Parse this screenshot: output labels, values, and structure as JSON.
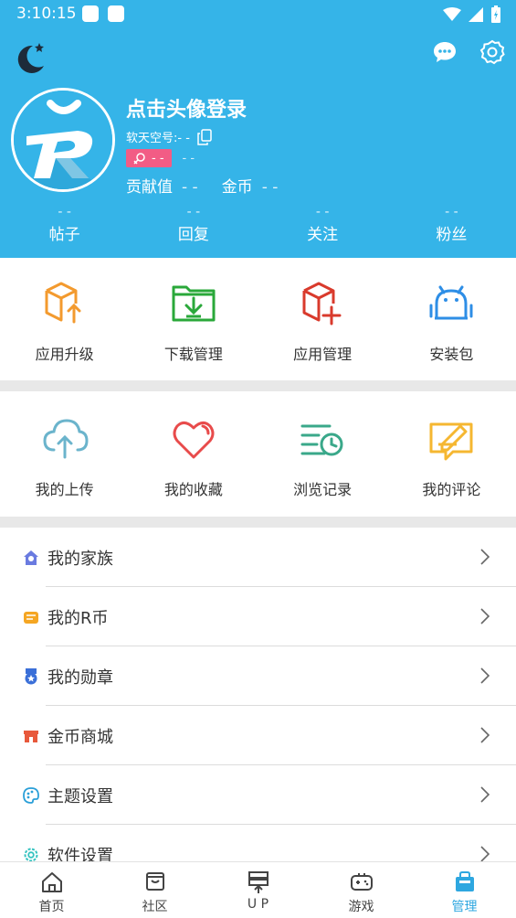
{
  "status_bar": {
    "time": "3:10:15"
  },
  "profile": {
    "login_prompt": "点击头像登录",
    "id_label": "软天空号:- -",
    "badge_value": "- -",
    "badge_extra": "- -",
    "contribution_label": "贡献值",
    "contribution_value": "- -",
    "coins_label": "金币",
    "coins_value": "- -"
  },
  "counts": [
    {
      "value": "- -",
      "label": "帖子"
    },
    {
      "value": "- -",
      "label": "回复"
    },
    {
      "value": "- -",
      "label": "关注"
    },
    {
      "value": "- -",
      "label": "粉丝"
    }
  ],
  "grid1": [
    {
      "label": "应用升级",
      "icon": "box-upgrade-icon"
    },
    {
      "label": "下载管理",
      "icon": "download-folder-icon"
    },
    {
      "label": "应用管理",
      "icon": "box-add-icon"
    },
    {
      "label": "安装包",
      "icon": "android-icon"
    }
  ],
  "grid2": [
    {
      "label": "我的上传",
      "icon": "cloud-upload-icon"
    },
    {
      "label": "我的收藏",
      "icon": "heart-icon"
    },
    {
      "label": "浏览记录",
      "icon": "history-icon"
    },
    {
      "label": "我的评论",
      "icon": "comment-edit-icon"
    }
  ],
  "menu": [
    {
      "label": "我的家族",
      "icon": "family-icon"
    },
    {
      "label": "我的R币",
      "icon": "rcoin-icon"
    },
    {
      "label": "我的勋章",
      "icon": "medal-icon"
    },
    {
      "label": "金币商城",
      "icon": "store-icon"
    },
    {
      "label": "主题设置",
      "icon": "palette-icon"
    },
    {
      "label": "软件设置",
      "icon": "gear-icon"
    }
  ],
  "bottom_nav": [
    {
      "label": "首页",
      "icon": "home-icon",
      "active": false
    },
    {
      "label": "社区",
      "icon": "community-icon",
      "active": false
    },
    {
      "label": "U P",
      "icon": "up-icon",
      "active": false
    },
    {
      "label": "游戏",
      "icon": "gamepad-icon",
      "active": false
    },
    {
      "label": "管理",
      "icon": "manage-icon",
      "active": true
    }
  ],
  "colors": {
    "header_bg": "#35b4e8",
    "badge_bg": "#f25c85",
    "active_nav": "#2ea7e0",
    "separator": "#e8e8e8"
  }
}
